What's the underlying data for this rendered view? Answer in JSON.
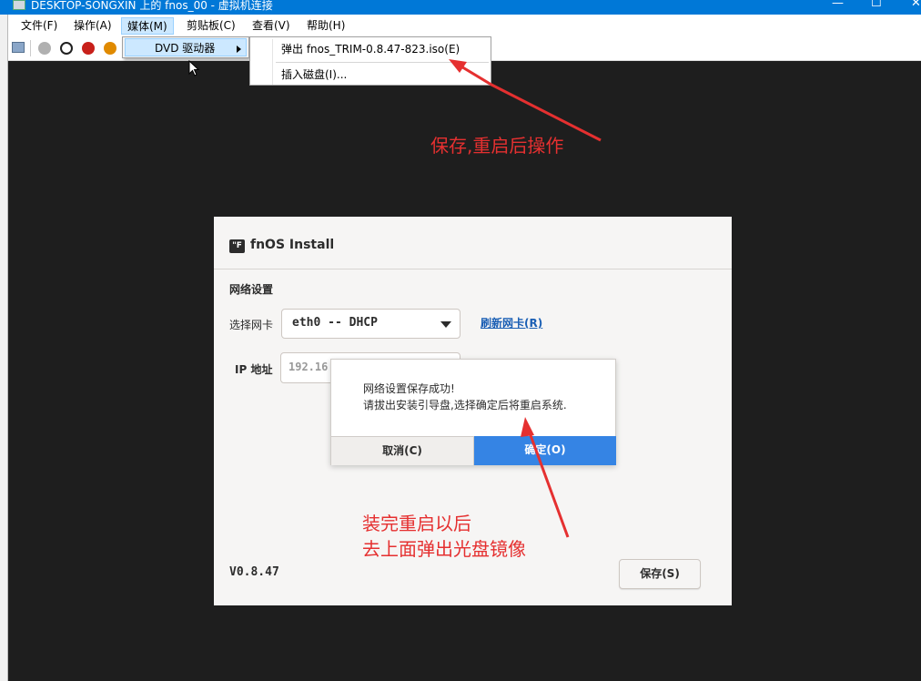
{
  "window": {
    "title": "DESKTOP-SONGXIN 上的 fnos_00 - 虚拟机连接",
    "minimize_glyph": "—",
    "maximize_glyph": "☐",
    "close_glyph": "✕"
  },
  "menubar": {
    "items": [
      {
        "label": "文件(F)"
      },
      {
        "label": "操作(A)"
      },
      {
        "label": "媒体(M)"
      },
      {
        "label": "剪贴板(C)"
      },
      {
        "label": "查看(V)"
      },
      {
        "label": "帮助(H)"
      }
    ]
  },
  "media_menu": {
    "dvd_label": "DVD 驱动器",
    "submenu": {
      "eject": "弹出 fnos_TRIM-0.8.47-823.iso(E)",
      "insert": "插入磁盘(I)..."
    }
  },
  "toolbar": {
    "icons": [
      "ctrl-alt-del-icon",
      "start-icon",
      "turn-off-icon",
      "shutdown-icon",
      "save-state-icon"
    ],
    "colors": {
      "start": "#b0b0b0",
      "turn_off": "#202020",
      "shutdown": "#c8201a",
      "save": "#e08a00"
    }
  },
  "installer": {
    "title": "fnOS Install",
    "logo_glyph": "\"F",
    "section_title": "网络设置",
    "nic_label": "选择网卡",
    "nic_value": "eth0 -- DHCP",
    "refresh_link": "刷新网卡(R)",
    "ip_label": "IP 地址",
    "ip_value": "192.16",
    "version": "V0.8.47",
    "save_button": "保存(S)"
  },
  "dialog": {
    "line1": "网络设置保存成功!",
    "line2": "请拔出安装引导盘,选择确定后将重启系统.",
    "cancel": "取消(C)",
    "ok": "确定(O)"
  },
  "annotations": {
    "top": "保存,重启后操作",
    "bottom_line1": "装完重启以后",
    "bottom_line2": "去上面弹出光盘镜像",
    "color": "#e53030"
  }
}
